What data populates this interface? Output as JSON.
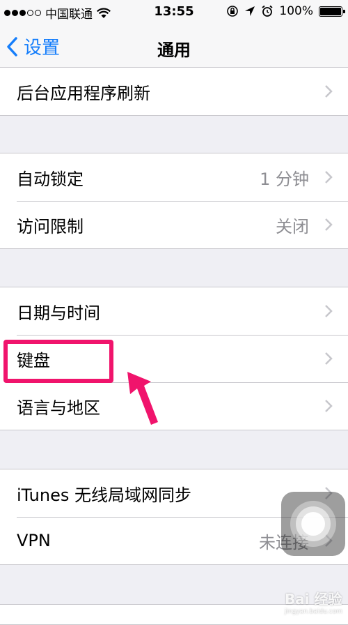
{
  "status_bar": {
    "carrier": "中国联通",
    "time": "13:55",
    "battery": "100%",
    "signal_dots_filled": 3,
    "signal_dots_total": 5,
    "battery_level": 1.0
  },
  "nav": {
    "back_label": "设置",
    "title": "通用"
  },
  "groups": [
    {
      "rows": [
        {
          "label": "后台应用程序刷新",
          "value": ""
        }
      ]
    },
    {
      "rows": [
        {
          "label": "自动锁定",
          "value": "1 分钟"
        },
        {
          "label": "访问限制",
          "value": "关闭"
        }
      ]
    },
    {
      "rows": [
        {
          "label": "日期与时间",
          "value": ""
        },
        {
          "label": "键盘",
          "value": ""
        },
        {
          "label": "语言与地区",
          "value": ""
        }
      ]
    },
    {
      "rows": [
        {
          "label": "iTunes 无线局域网同步",
          "value": ""
        },
        {
          "label": "VPN",
          "value": "未连接"
        }
      ]
    }
  ],
  "watermark": {
    "brand": "Bai 经验",
    "url": "jingyan.baidu.com"
  },
  "colors": {
    "accent": "#157efb",
    "highlight": "#f0146c",
    "background": "#efeff4",
    "separator": "#c8c7cc",
    "secondary_text": "#8e8e93"
  }
}
